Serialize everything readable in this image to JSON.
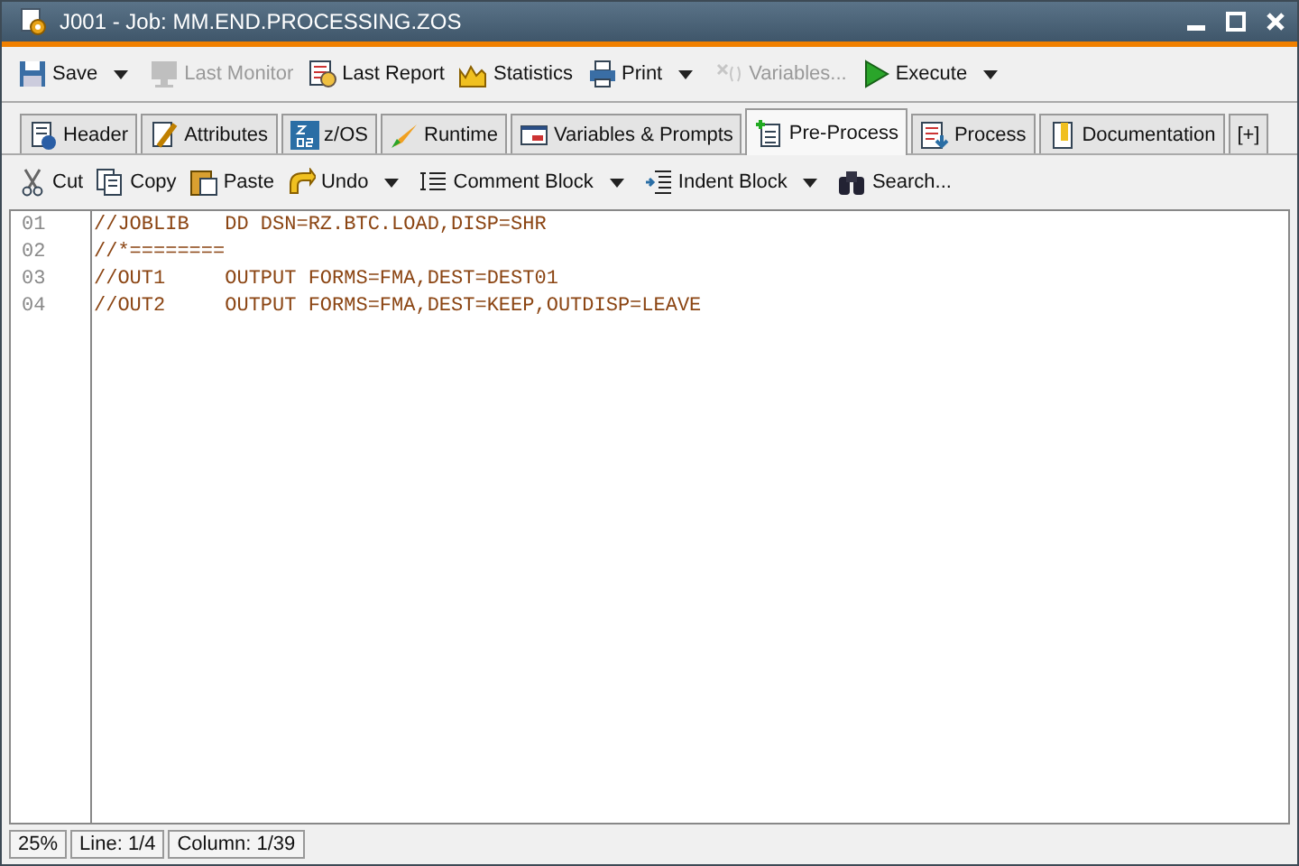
{
  "window": {
    "title": "J001 - Job: MM.END.PROCESSING.ZOS"
  },
  "toolbar": [
    {
      "label": "Save",
      "disabled": false,
      "has_menu": true
    },
    {
      "label": "Last Monitor",
      "disabled": true,
      "has_menu": false
    },
    {
      "label": "Last Report",
      "disabled": false,
      "has_menu": false
    },
    {
      "label": "Statistics",
      "disabled": false,
      "has_menu": false
    },
    {
      "label": "Print",
      "disabled": false,
      "has_menu": true
    },
    {
      "label": "Variables...",
      "disabled": true,
      "has_menu": false
    },
    {
      "label": "Execute",
      "disabled": false,
      "has_menu": true
    }
  ],
  "tabs": [
    {
      "label": "Header",
      "selected": false
    },
    {
      "label": "Attributes",
      "selected": false
    },
    {
      "label": "z/OS",
      "selected": false
    },
    {
      "label": "Runtime",
      "selected": false
    },
    {
      "label": "Variables & Prompts",
      "selected": false
    },
    {
      "label": "Pre-Process",
      "selected": true
    },
    {
      "label": "Process",
      "selected": false
    },
    {
      "label": "Documentation",
      "selected": false
    },
    {
      "label": "[+]",
      "selected": false
    }
  ],
  "edit_toolbar": [
    {
      "label": "Cut",
      "has_menu": false
    },
    {
      "label": "Copy",
      "has_menu": false
    },
    {
      "label": "Paste",
      "has_menu": false
    },
    {
      "label": "Undo",
      "has_menu": true
    },
    {
      "label": "Comment Block",
      "has_menu": true
    },
    {
      "label": "Indent Block",
      "has_menu": true
    },
    {
      "label": "Search...",
      "has_menu": false
    }
  ],
  "editor": {
    "lines": [
      {
        "number": "01",
        "text": "//JOBLIB   DD DSN=RZ.BTC.LOAD,DISP=SHR"
      },
      {
        "number": "02",
        "text": "//*========"
      },
      {
        "number": "03",
        "text": "//OUT1     OUTPUT FORMS=FMA,DEST=DEST01"
      },
      {
        "number": "04",
        "text": "//OUT2     OUTPUT FORMS=FMA,DEST=KEEP,OUTDISP=LEAVE"
      }
    ]
  },
  "status_bar": [
    "25%",
    "Line: 1/4",
    "Column: 1/39"
  ]
}
